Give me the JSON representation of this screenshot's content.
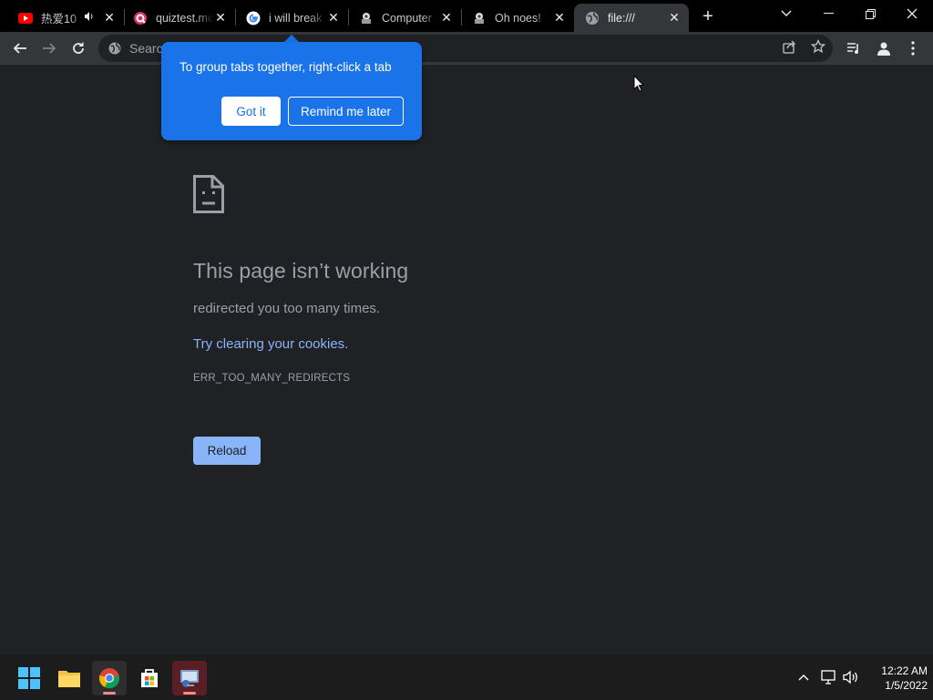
{
  "browser": {
    "tabs": [
      {
        "title": "热爱10",
        "icon": "youtube-icon",
        "audio": true
      },
      {
        "title": "quiztest.me",
        "icon": "quiz-icon",
        "audio": false
      },
      {
        "title": "i will break",
        "icon": "google-icon",
        "audio": false
      },
      {
        "title": "Computer",
        "icon": "site-logo-icon",
        "audio": false
      },
      {
        "title": "Oh noes!",
        "icon": "site-logo-icon",
        "audio": false
      },
      {
        "title": "file:///",
        "icon": "globe-icon",
        "audio": false,
        "active": true
      }
    ],
    "omnibox": {
      "placeholder": "Search Google or type a URL",
      "value": ""
    }
  },
  "promo": {
    "text": "To group tabs together, right-click a tab",
    "got_it": "Got it",
    "remind": "Remind me later"
  },
  "error_page": {
    "title": "This page isn’t working",
    "description": "redirected you too many times.",
    "link": "Try clearing your cookies",
    "link_suffix": ".",
    "code": "ERR_TOO_MANY_REDIRECTS",
    "reload": "Reload"
  },
  "taskbar": {
    "time": "12:22 AM",
    "date": "1/5/2022"
  },
  "colors": {
    "accent": "#1a73e8",
    "link": "#8ab4f8",
    "page_bg": "#202124"
  }
}
